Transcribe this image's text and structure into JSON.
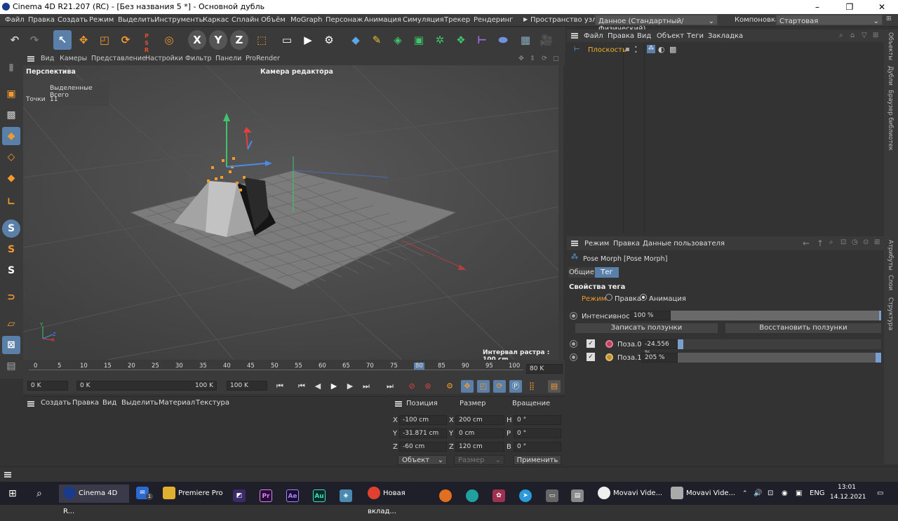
{
  "window": {
    "title": "Cinema 4D R21.207 (RC) - [Без названия 5 *] - Основной дубль",
    "minimize": "–",
    "maximize": "❐",
    "close": "✕"
  },
  "menu": [
    "Файл",
    "Правка",
    "Создать",
    "Режим",
    "Выделить",
    "Инструменты",
    "Каркас",
    "Сплайн",
    "Объём",
    "MoGraph",
    "Персонаж",
    "Анимация",
    "Симуляция",
    "Трекер",
    "Рендеринг"
  ],
  "nodespace": {
    "label": "Пространство узлов:",
    "value": "Данное (Стандартный/Физический)"
  },
  "layout": {
    "label": "Компоновка",
    "value": "Стартовая"
  },
  "viewport": {
    "menu": [
      "Вид",
      "Камеры",
      "Представление",
      "Настройки",
      "Фильтр",
      "Панели",
      "ProRender"
    ],
    "view_name": "Перспектива",
    "camera": "Камера редактора",
    "stats_header": "Выделенные Всего",
    "stats_label": "Точки",
    "stats_value": "11",
    "grid_interval": "Интервал растра : 100 cm",
    "axis_y": "Y",
    "axis_z": "Z",
    "axis_x": "X"
  },
  "timeline": {
    "ticks": [
      "0",
      "5",
      "10",
      "15",
      "20",
      "25",
      "30",
      "35",
      "40",
      "45",
      "50",
      "55",
      "60",
      "65",
      "70",
      "75",
      "80",
      "85",
      "90",
      "95",
      "100"
    ],
    "current": "80",
    "end_field": "80 K"
  },
  "transport": {
    "start": "0 K",
    "current": "0 K",
    "end": "100 K",
    "end2": "100 K"
  },
  "materials": {
    "menu": [
      "Создать",
      "Правка",
      "Вид",
      "Выделить",
      "Материал",
      "Текстура"
    ]
  },
  "coords": {
    "headers": [
      "Позиция",
      "Размер",
      "Вращение"
    ],
    "rows": [
      {
        "axis": "X",
        "pos": "-100 cm",
        "size_axis": "X",
        "size": "200 cm",
        "rot_axis": "H",
        "rot": "0 °"
      },
      {
        "axis": "Y",
        "pos": "-31.871 cm",
        "size_axis": "Y",
        "size": "0 cm",
        "rot_axis": "P",
        "rot": "0 °"
      },
      {
        "axis": "Z",
        "pos": "-60 cm",
        "size_axis": "Z",
        "size": "120 cm",
        "rot_axis": "B",
        "rot": "0 °"
      }
    ],
    "mode": "Объект",
    "size_mode": "Размер",
    "apply": "Применить"
  },
  "objects": {
    "menu": [
      "Файл",
      "Правка",
      "Вид",
      "Объект",
      "Теги",
      "Закладка"
    ],
    "item": "Плоскость"
  },
  "attributes": {
    "menu": [
      "Режим",
      "Правка",
      "Данные пользователя"
    ],
    "title": "Pose Morph [Pose Morph]",
    "tabs": [
      "Общие",
      "Тег"
    ],
    "section": "Свойства тега",
    "mode_label": "Режим",
    "mode_edit": "Правка",
    "mode_anim": "Анимация",
    "intensity_label": "Интенсивность",
    "intensity_value": "100 %",
    "intensity_level": 1.0,
    "btn_record": "Записать ползунки",
    "btn_restore": "Восстановить ползунки",
    "poses": [
      {
        "name": "Поза.0",
        "value": "-24.556 %",
        "level": 0.0
      },
      {
        "name": "Поза.1",
        "value": "205 %",
        "level": 1.0
      }
    ]
  },
  "right_tabs": [
    "Объекты",
    "Дубли",
    "Браузер библиотек",
    "Атрибуты",
    "Слои",
    "Структура"
  ],
  "taskbar": {
    "items": [
      {
        "label": "Cinema 4D R...",
        "badge": ""
      },
      {
        "label": "",
        "badge": "1"
      },
      {
        "label": "Premiere Pro",
        "badge": ""
      },
      {
        "label": "",
        "badge": "Pr"
      },
      {
        "label": "",
        "badge": "Ae"
      },
      {
        "label": "",
        "badge": "Au"
      },
      {
        "label": "Новая вклад...",
        "badge": ""
      },
      {
        "label": "Movavi Vide...",
        "badge": ""
      },
      {
        "label": "Movavi Vide...",
        "badge": ""
      }
    ],
    "lang": "ENG",
    "time": "13:01",
    "date": "14.12.2021"
  }
}
